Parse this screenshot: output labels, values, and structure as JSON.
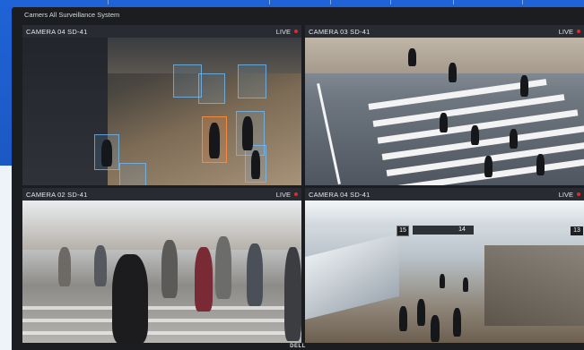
{
  "app": {
    "title": "Camers All Surveillance System",
    "brand": "DELL"
  },
  "panes": [
    {
      "camera": "CAMERA 04 SD-41",
      "status": "LIVE"
    },
    {
      "camera": "CAMERA 03 SD-41",
      "status": "LIVE"
    },
    {
      "camera": "CAMERA 02 SD-41",
      "status": "LIVE"
    },
    {
      "camera": "CAMERA 04 SD-41",
      "status": "LIVE"
    }
  ],
  "station": {
    "sign_left": "15",
    "sign_mid": "14",
    "sign_right": "13"
  },
  "colors": {
    "live_indicator": "#e02b2b",
    "detection_box": "#6ebeff",
    "background": "#1f63d6"
  }
}
